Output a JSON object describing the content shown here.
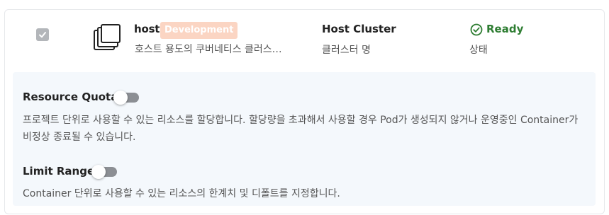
{
  "cluster": {
    "checked": true,
    "name": "host",
    "environment_badge": "Development",
    "description": "호스트 용도의 쿠버네티스 클러스…",
    "cluster_type": "Host Cluster",
    "cluster_type_caption": "클러스터 명",
    "status": "Ready",
    "status_caption": "상태",
    "status_color": "#2e7d32",
    "badge_color": "#fbd5c3"
  },
  "settings": {
    "resource_quota": {
      "title": "Resource Quota",
      "enabled": false,
      "description": "프로젝트 단위로 사용할 수 있는 리소스를 할당합니다. 할당량을 초과해서 사용할 경우 Pod가 생성되지 않거나 운영중인 Container가 비정상 종료될 수 있습니다."
    },
    "limit_range": {
      "title": "Limit Range",
      "enabled": false,
      "description": "Container 단위로 사용할 수 있는 리소스의 한계치 및 디폴트를 지정합니다."
    }
  }
}
